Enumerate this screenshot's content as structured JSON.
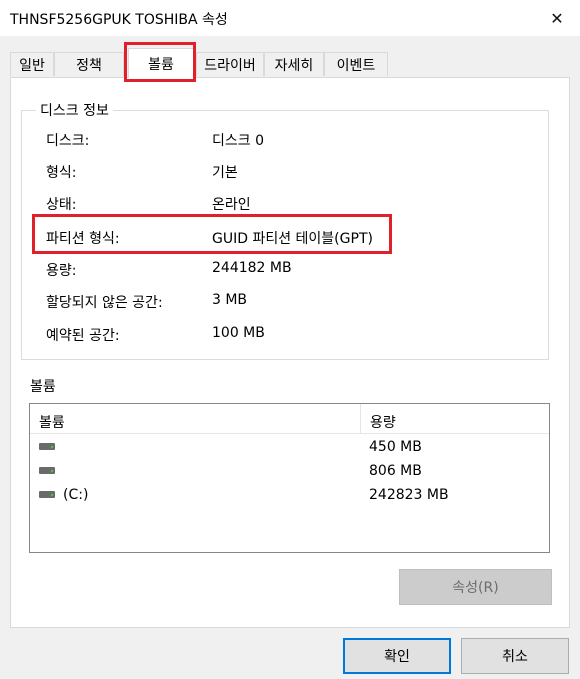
{
  "window": {
    "title": "THNSF5256GPUK TOSHIBA 속성",
    "close_glyph": "✕"
  },
  "tabs": [
    {
      "label": "일반",
      "selected": false
    },
    {
      "label": "정책",
      "selected": false
    },
    {
      "label": "볼륨",
      "selected": true
    },
    {
      "label": "드라이버",
      "selected": false
    },
    {
      "label": "자세히",
      "selected": false
    },
    {
      "label": "이벤트",
      "selected": false
    }
  ],
  "disk_info": {
    "title": "디스크 정보",
    "rows": [
      {
        "label": "디스크:",
        "value": "디스크 0"
      },
      {
        "label": "형식:",
        "value": "기본"
      },
      {
        "label": "상태:",
        "value": "온라인"
      },
      {
        "label": "파티션 형식:",
        "value": "GUID 파티션 테이블(GPT)"
      },
      {
        "label": "용량:",
        "value": "244182 MB"
      },
      {
        "label": "할당되지 않은 공간:",
        "value": "3 MB"
      },
      {
        "label": "예약된 공간:",
        "value": "100 MB"
      }
    ]
  },
  "volumes": {
    "label": "볼륨",
    "columns": {
      "name": "볼륨",
      "capacity": "용량"
    },
    "rows": [
      {
        "name": "",
        "capacity": "450 MB"
      },
      {
        "name": "",
        "capacity": "806 MB"
      },
      {
        "name": "(C:)",
        "capacity": "242823 MB"
      }
    ],
    "properties_button": "속성(R)"
  },
  "buttons": {
    "ok": "확인",
    "cancel": "취소"
  },
  "colors": {
    "highlight": "#e0202a",
    "accent": "#0078d7"
  }
}
